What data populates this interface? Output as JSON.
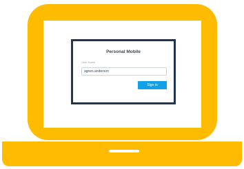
{
  "login": {
    "title": "Personal Mobile",
    "username_label": "User Name",
    "username_value": "agnes.anderson",
    "signin_label": "Sign in"
  },
  "colors": {
    "laptop": "#ffbb00",
    "card_border": "#1f3650",
    "signin_button": "#12a0e8"
  },
  "icons": {
    "device": "laptop-icon"
  }
}
